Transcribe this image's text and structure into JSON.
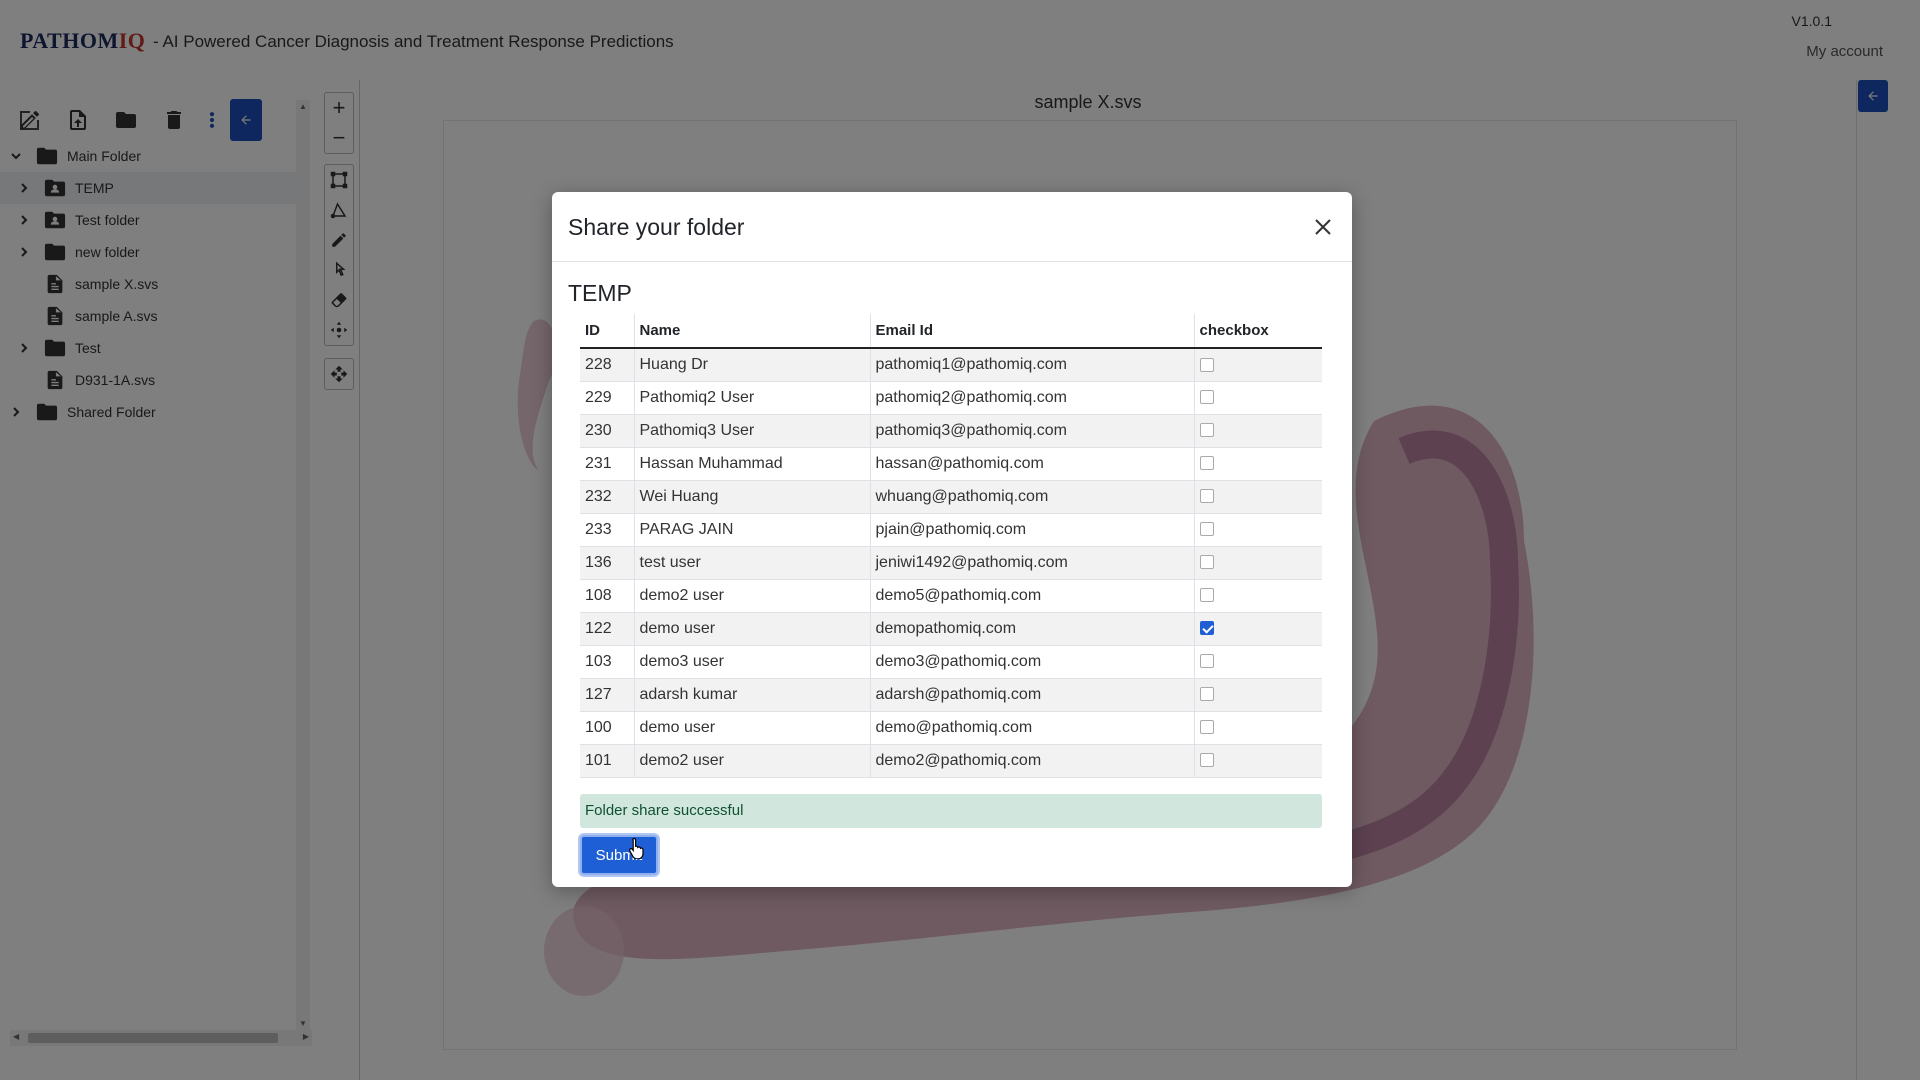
{
  "header": {
    "brand_part1": "PATHOM",
    "brand_part2": "IQ",
    "tagline": "- AI Powered Cancer Diagnosis and Treatment Response Predictions",
    "version": "V1.0.1",
    "account": "My account"
  },
  "toolbar": {
    "icons": [
      "edit-icon",
      "upload-file-icon",
      "folder-icon",
      "trash-icon",
      "more-vertical-icon",
      "collapse-left-icon"
    ]
  },
  "tree": {
    "items": [
      {
        "label": "Main Folder",
        "icon": "folder-icon",
        "chevron": "down"
      },
      {
        "label": "TEMP",
        "icon": "shared-folder-icon",
        "chevron": "right"
      },
      {
        "label": "Test folder",
        "icon": "shared-folder-icon",
        "chevron": "right"
      },
      {
        "label": "new folder",
        "icon": "folder-icon",
        "chevron": "right"
      },
      {
        "label": "sample X.svs",
        "icon": "file-icon",
        "chevron": ""
      },
      {
        "label": "sample A.svs",
        "icon": "file-icon",
        "chevron": ""
      },
      {
        "label": "Test",
        "icon": "folder-icon",
        "chevron": "right"
      },
      {
        "label": "D931-1A.svs",
        "icon": "file-icon",
        "chevron": ""
      },
      {
        "label": "Shared Folder",
        "icon": "folder-icon",
        "chevron": "right"
      }
    ]
  },
  "viewer": {
    "title": "sample X.svs",
    "zoom_in": "+",
    "zoom_out": "−"
  },
  "modal": {
    "title": "Share your folder",
    "folder": "TEMP",
    "columns": [
      "ID",
      "Name",
      "Email Id",
      "checkbox"
    ],
    "rows": [
      {
        "id": "228",
        "name": "Huang Dr",
        "email": "pathomiq1@pathomiq.com",
        "checked": false
      },
      {
        "id": "229",
        "name": "Pathomiq2 User",
        "email": "pathomiq2@pathomiq.com",
        "checked": false
      },
      {
        "id": "230",
        "name": "Pathomiq3 User",
        "email": "pathomiq3@pathomiq.com",
        "checked": false
      },
      {
        "id": "231",
        "name": "Hassan Muhammad",
        "email": "hassan@pathomiq.com",
        "checked": false
      },
      {
        "id": "232",
        "name": "Wei Huang",
        "email": "whuang@pathomiq.com",
        "checked": false
      },
      {
        "id": "233",
        "name": "PARAG JAIN",
        "email": "pjain@pathomiq.com",
        "checked": false
      },
      {
        "id": "136",
        "name": "test user",
        "email": "jeniwi1492@pathomiq.com",
        "checked": false
      },
      {
        "id": "108",
        "name": "demo2 user",
        "email": "demo5@pathomiq.com",
        "checked": false
      },
      {
        "id": "122",
        "name": "demo user",
        "email": "demopathomiq.com",
        "checked": true
      },
      {
        "id": "103",
        "name": "demo3 user",
        "email": "demo3@pathomiq.com",
        "checked": false
      },
      {
        "id": "127",
        "name": "adarsh kumar",
        "email": "adarsh@pathomiq.com",
        "checked": false
      },
      {
        "id": "100",
        "name": "demo user",
        "email": "demo@pathomiq.com",
        "checked": false
      },
      {
        "id": "101",
        "name": "demo2 user",
        "email": "demo2@pathomiq.com",
        "checked": false
      }
    ],
    "alert": "Folder share successful",
    "submit_label": "Submit"
  },
  "colors": {
    "primary": "#1f5fd6",
    "brand_dark": "#1a2a5e",
    "brand_red": "#c0392b",
    "success_bg": "#d1e7dd"
  }
}
